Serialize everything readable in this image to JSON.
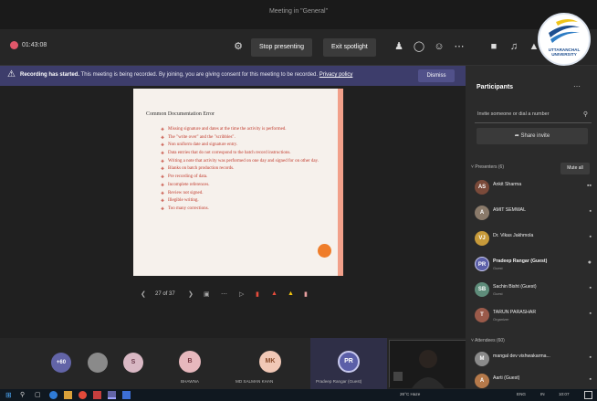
{
  "window": {
    "title": "Meeting in \"General\""
  },
  "toolbar": {
    "timer": "01:43:08",
    "stop_presenting_label": "Stop presenting",
    "exit_spotlight_label": "Exit spotlight",
    "more_label": "⋯"
  },
  "logo": {
    "line1": "UTTARANCHAL",
    "line2": "UNIVERSITY"
  },
  "banner": {
    "bold_text": "Recording has started.",
    "message": "This meeting is being recorded. By joining, you are giving consent for this meeting to be recorded.",
    "link_text": "Privacy policy",
    "dismiss_label": "Dismiss"
  },
  "slide": {
    "title": "Common Documentation Error",
    "bullets": [
      "Missing signature and dates at the time the activity is performed.",
      "The \"write over\" and the \"scribbles\".",
      "Non uniform date and signature entry.",
      "Data entries that do not correspond to the batch record instructions.",
      "Writing a note that activity was performed on one day and signed for on other day.",
      "Blanks on batch production records.",
      "Pre recording of data.",
      "Incomplete references.",
      "Review not signed.",
      "Illegible writing.",
      "Too many corrections."
    ]
  },
  "slide_nav": {
    "page_indicator": "27 of 37"
  },
  "tray": {
    "overflow_count": "+60",
    "avatars": [
      {
        "initial": "S",
        "name": ""
      },
      {
        "initial": "B",
        "name": "BHAWNA"
      },
      {
        "initial": "MK",
        "name": "MD SALMAN KHAN"
      },
      {
        "initial": "PR",
        "name": "Pradeep Rangar (Guest)"
      }
    ]
  },
  "sidebar": {
    "title": "Participants",
    "invite_placeholder": "Invite someone or dial a number",
    "share_invite_label": "Share invite",
    "presenters_label": "Presenters (6)",
    "mute_all_label": "Mute all",
    "presenters": [
      {
        "name": "Ankit Sharma",
        "sub": "",
        "initials": "AS"
      },
      {
        "name": "AMIT SEMWAL",
        "sub": "",
        "initials": "A"
      },
      {
        "name": "Dr. Vikas Jakhmola",
        "sub": "",
        "initials": "VJ"
      },
      {
        "name": "Pradeep Rangar (Guest)",
        "sub": "Guest",
        "initials": "PR"
      },
      {
        "name": "Sachin Bisht (Guest)",
        "sub": "Guest",
        "initials": "SB"
      },
      {
        "name": "TARUN PARASHAR",
        "sub": "Organizer",
        "initials": "T"
      }
    ],
    "attendees_label": "Attendees (60)",
    "attendees": [
      {
        "name": "mangal dev vishwakarma...",
        "sub": "",
        "initials": "M"
      },
      {
        "name": "Aarti (Guest)",
        "sub": "Guest",
        "initials": "A"
      }
    ]
  },
  "taskbar": {
    "weather": "26°C Haze",
    "lang": "ENG",
    "time": "10:07",
    "date": "IN"
  },
  "colors": {
    "banner": "#3d3d6b",
    "slide_text": "#c0392b",
    "accent_orange": "#ef7d2a",
    "teams_purple": "#6264a7"
  }
}
